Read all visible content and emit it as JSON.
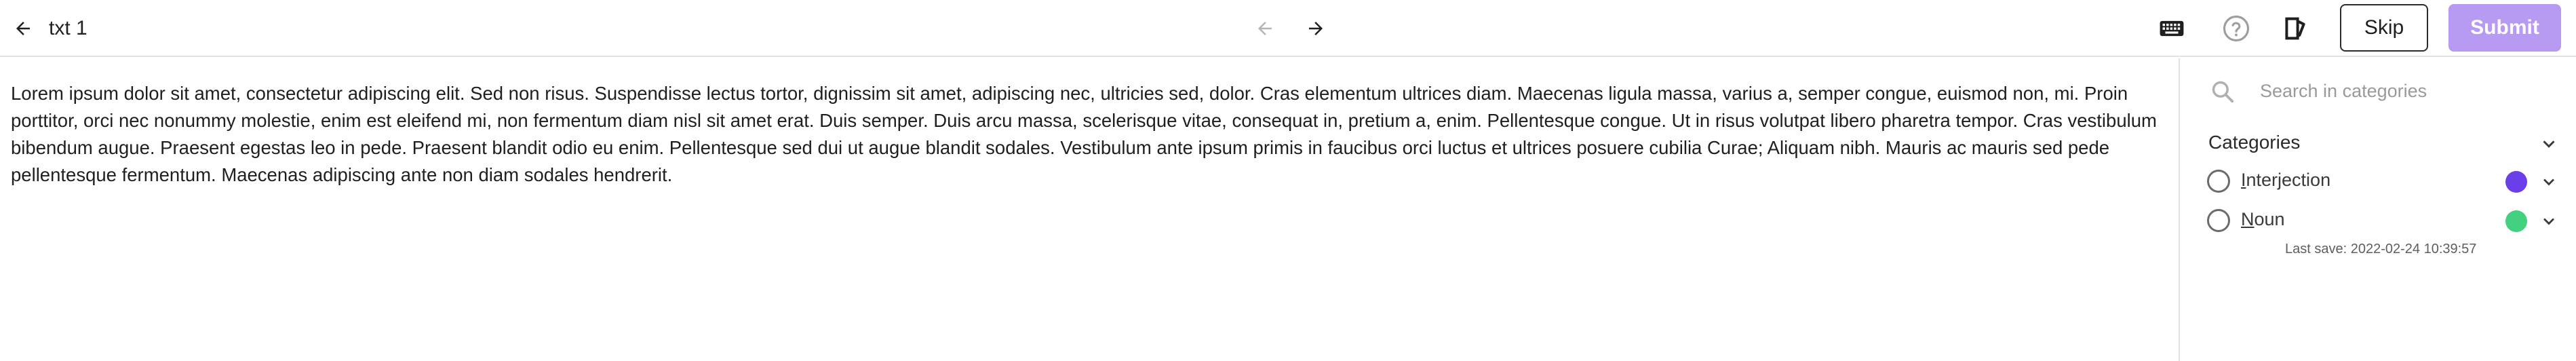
{
  "header": {
    "document_title": "txt 1",
    "skip_label": "Skip",
    "submit_label": "Submit",
    "icons": {
      "back": "arrow-left-icon",
      "prev": "arrow-left-icon",
      "next": "arrow-right-icon",
      "keyboard": "keyboard-icon",
      "help": "help-circle-icon",
      "mode": "annotation-mode-icon"
    }
  },
  "document": {
    "text": "Lorem ipsum dolor sit amet, consectetur adipiscing elit. Sed non risus. Suspendisse lectus tortor, dignissim sit amet, adipiscing nec, ultricies sed, dolor. Cras elementum ultrices diam. Maecenas ligula massa, varius a, semper congue, euismod non, mi. Proin porttitor, orci nec nonummy molestie, enim est eleifend mi, non fermentum diam nisl sit amet erat. Duis semper. Duis arcu massa, scelerisque vitae, consequat in, pretium a, enim. Pellentesque congue. Ut in risus volutpat libero pharetra tempor. Cras vestibulum bibendum augue. Praesent egestas leo in pede. Praesent blandit odio eu enim. Pellentesque sed dui ut augue blandit sodales. Vestibulum ante ipsum primis in faucibus orci luctus et ultrices posuere cubilia Curae; Aliquam nibh. Mauris ac mauris sed pede pellentesque fermentum. Maecenas adipiscing ante non diam sodales hendrerit."
  },
  "sidebar": {
    "search_placeholder": "Search in categories",
    "categories_label": "Categories",
    "categories": [
      {
        "hotkey": "I",
        "rest": "nterjection",
        "color": "#6a3ee8"
      },
      {
        "hotkey": "N",
        "rest": "oun",
        "color": "#43d17f"
      }
    ],
    "last_save": "Last save: 2022-02-24 10:39:57"
  },
  "colors": {
    "submit_bg": "#b79af2",
    "border": "#e3e3e3"
  }
}
